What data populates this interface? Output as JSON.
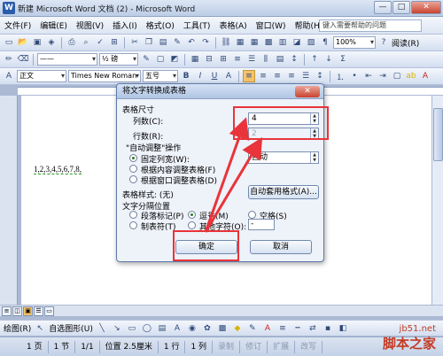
{
  "window": {
    "title": "新建 Microsoft Word 文档 (2) - Microsoft Word",
    "minimize": "—",
    "maximize": "□",
    "close": "✕"
  },
  "menu": {
    "items": [
      "文件(F)",
      "编辑(E)",
      "视图(V)",
      "插入(I)",
      "格式(O)",
      "工具(T)",
      "表格(A)",
      "窗口(W)",
      "帮助(H)"
    ],
    "help_placeholder": "键入需要帮助的问题"
  },
  "toolbar": {
    "zoom": "100%",
    "read_button": "阅读(R)",
    "line_weight": "½ 磅",
    "style": "正文",
    "font": "Times New Roman",
    "size": "五号",
    "bold": "B",
    "italic": "I",
    "underline": "U"
  },
  "document": {
    "text": "1,2,3,4,5,6,7,8,"
  },
  "dialog": {
    "title": "将文字转换成表格",
    "close": "✕",
    "section_size": "表格尺寸",
    "columns_label": "列数(C):",
    "columns_value": "4",
    "rows_label": "行数(R):",
    "rows_value": "2",
    "autofit_label": "\"自动调整\"操作",
    "fixed_width": "固定列宽(W):",
    "fixed_width_value": "自动",
    "fit_content": "根据内容调整表格(F)",
    "fit_window": "根据窗口调整表格(D)",
    "table_style_label": "表格样式: (无)",
    "autoformat_button": "自动套用格式(A)...",
    "separator_label": "文字分隔位置",
    "sep_paragraph": "段落标记(P)",
    "sep_comma": "逗号(M)",
    "sep_space": "空格(S)",
    "sep_tab": "制表符(T)",
    "sep_other": "其他字符(O):",
    "sep_other_value": "-",
    "ok": "确定",
    "cancel": "取消"
  },
  "drawbar": {
    "draw": "绘图(R)",
    "autoshapes": "自选图形(U)"
  },
  "status": {
    "page": "1 页",
    "section": "1 节",
    "pages": "1/1",
    "position": "位置 2.5厘米",
    "line": "1 行",
    "column": "1 列",
    "rec": "录制",
    "trk": "修订",
    "ext": "扩展",
    "ovr": "改写"
  },
  "watermark": {
    "top": "jb51.net",
    "bottom": "脚本之家"
  },
  "colors": {
    "highlight": "#e8343a",
    "accent": "#2b5cab"
  }
}
